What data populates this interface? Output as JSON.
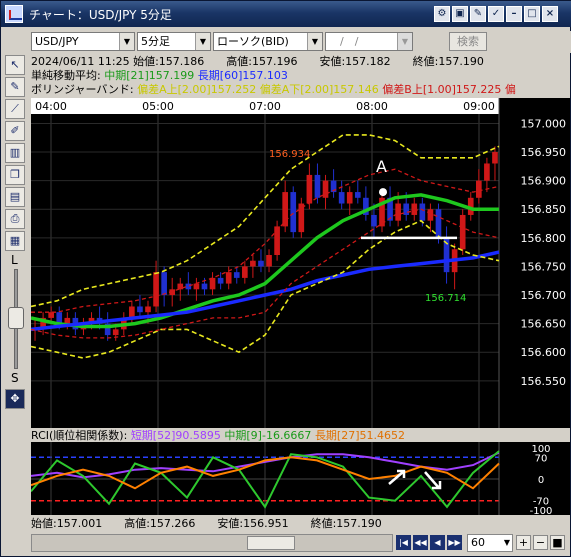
{
  "window": {
    "title": "チャート：USD/JPY 5分足",
    "buttons": [
      "gear-icon",
      "camera-icon",
      "palette-icon",
      "pin-icon",
      "minimize-icon",
      "restore-icon",
      "close-icon"
    ]
  },
  "toolbar": {
    "symbol": "USD/JPY",
    "timeframe": "5分足",
    "chart_type": "ローソク(BID)",
    "date_placeholder": "　/　/",
    "search_label": "検索"
  },
  "left_tools": {
    "icons": [
      "cursor-icon",
      "pen-icon",
      "trendline-icon",
      "draw-tool-icon",
      "bar-chart-icon",
      "copy-icon",
      "layers-icon",
      "print-icon",
      "save-icon"
    ],
    "large_label": "L",
    "small_label": "S",
    "move_icon": "move-icon"
  },
  "info": {
    "line1": "2024/06/11 11:25  始値:157.186　　高値:157.196　　安値:157.182　　終値:157.190",
    "ma_label": "単純移動平均:",
    "ma_mid": "中期[21]157.199",
    "ma_long": "長期[60]157.103",
    "bb_label": "ボリンジャーバンド:",
    "bb_upper_a": "偏差A上[2.00]157.252",
    "bb_lower_a": "偏差A下[2.00]157.146",
    "bb_upper_b": "偏差B上[1.00]157.225",
    "bb_cut": "偏"
  },
  "rci": {
    "label": "RCI(順位相関係数):",
    "short": "短期[52]90.5895",
    "mid": "中期[9]-16.6667",
    "long": "長期[27]51.4652",
    "levels": [
      "100",
      "70",
      "0",
      "-70",
      "-100"
    ]
  },
  "bottom": {
    "text": "始値:157.001　　高値:157.266　　安値:156.951　　終値:157.190",
    "zoom": "60"
  },
  "colors": {
    "ma_mid": "#1ec81e",
    "ma_long": "#1a2aff",
    "band_a": "#e8e81e",
    "band_b": "#d01818",
    "candle_up": "#d01818",
    "candle_down": "#2030d0",
    "rci_short": "#a040ff",
    "rci_mid": "#2ec82e",
    "rci_long": "#ff8000"
  },
  "chart_data": {
    "type": "line",
    "title": "USD/JPY 5分足",
    "x_ticks": [
      "04:00",
      "05:00",
      "07:00",
      "08:00",
      "09:00"
    ],
    "y_ticks": [
      156.55,
      156.6,
      156.65,
      156.7,
      156.75,
      156.8,
      156.85,
      156.9,
      156.95,
      157.0
    ],
    "ylim": [
      156.52,
      157.02
    ],
    "annotations": [
      "156.934",
      "156.714",
      "A"
    ],
    "candles": [
      [
        156.64,
        156.66,
        156.62,
        156.64
      ],
      [
        156.64,
        156.67,
        156.63,
        156.66
      ],
      [
        156.66,
        156.68,
        156.65,
        156.67
      ],
      [
        156.67,
        156.68,
        156.64,
        156.65
      ],
      [
        156.65,
        156.67,
        156.64,
        156.66
      ],
      [
        156.66,
        156.67,
        156.63,
        156.64
      ],
      [
        156.64,
        156.66,
        156.63,
        156.65
      ],
      [
        156.65,
        156.67,
        156.64,
        156.66
      ],
      [
        156.66,
        156.68,
        156.64,
        156.65
      ],
      [
        156.65,
        156.67,
        156.62,
        156.63
      ],
      [
        156.63,
        156.65,
        156.62,
        156.64
      ],
      [
        156.64,
        156.67,
        156.63,
        156.66
      ],
      [
        156.66,
        156.69,
        156.65,
        156.68
      ],
      [
        156.68,
        156.7,
        156.66,
        156.67
      ],
      [
        156.67,
        156.69,
        156.65,
        156.68
      ],
      [
        156.68,
        156.76,
        156.67,
        156.74
      ],
      [
        156.74,
        156.75,
        156.68,
        156.7
      ],
      [
        156.7,
        156.73,
        156.68,
        156.71
      ],
      [
        156.71,
        156.73,
        156.69,
        156.72
      ],
      [
        156.72,
        156.74,
        156.7,
        156.71
      ],
      [
        156.71,
        156.73,
        156.69,
        156.72
      ],
      [
        156.72,
        156.73,
        156.7,
        156.71
      ],
      [
        156.71,
        156.74,
        156.7,
        156.73
      ],
      [
        156.73,
        156.74,
        156.71,
        156.72
      ],
      [
        156.72,
        156.75,
        156.71,
        156.74
      ],
      [
        156.74,
        156.75,
        156.72,
        156.73
      ],
      [
        156.73,
        156.76,
        156.72,
        156.75
      ],
      [
        156.75,
        156.77,
        156.73,
        156.76
      ],
      [
        156.76,
        156.78,
        156.74,
        156.75
      ],
      [
        156.75,
        156.78,
        156.74,
        156.77
      ],
      [
        156.77,
        156.83,
        156.76,
        156.82
      ],
      [
        156.82,
        156.9,
        156.81,
        156.88
      ],
      [
        156.88,
        156.89,
        156.8,
        156.81
      ],
      [
        156.81,
        156.87,
        156.8,
        156.86
      ],
      [
        156.86,
        156.93,
        156.85,
        156.91
      ],
      [
        156.91,
        156.93,
        156.86,
        156.87
      ],
      [
        156.87,
        156.91,
        156.85,
        156.9
      ],
      [
        156.9,
        156.92,
        156.87,
        156.88
      ],
      [
        156.88,
        156.9,
        156.85,
        156.86
      ],
      [
        156.86,
        156.89,
        156.84,
        156.88
      ],
      [
        156.88,
        156.9,
        156.86,
        156.87
      ],
      [
        156.87,
        156.89,
        156.83,
        156.84
      ],
      [
        156.84,
        156.86,
        156.8,
        156.82
      ],
      [
        156.82,
        156.88,
        156.81,
        156.87
      ],
      [
        156.87,
        156.89,
        156.82,
        156.83
      ],
      [
        156.83,
        156.88,
        156.82,
        156.86
      ],
      [
        156.86,
        156.88,
        156.83,
        156.84
      ],
      [
        156.84,
        156.87,
        156.83,
        156.86
      ],
      [
        156.86,
        156.87,
        156.82,
        156.83
      ],
      [
        156.83,
        156.86,
        156.81,
        156.85
      ],
      [
        156.85,
        156.86,
        156.79,
        156.8
      ],
      [
        156.8,
        156.82,
        156.72,
        156.74
      ],
      [
        156.74,
        156.79,
        156.71,
        156.78
      ],
      [
        156.78,
        156.85,
        156.77,
        156.84
      ],
      [
        156.84,
        156.88,
        156.83,
        156.87
      ],
      [
        156.87,
        156.92,
        156.86,
        156.9
      ],
      [
        156.9,
        156.94,
        156.88,
        156.93
      ],
      [
        156.93,
        156.96,
        156.9,
        156.95
      ]
    ],
    "series": [
      {
        "name": "中期[21]",
        "values": [
          156.66,
          156.65,
          156.645,
          156.645,
          156.65,
          156.66,
          156.675,
          156.69,
          156.7,
          156.72,
          156.76,
          156.8,
          156.83,
          156.85,
          156.87,
          156.875,
          156.865,
          156.85,
          156.85
        ]
      },
      {
        "name": "長期[60]",
        "values": [
          156.64,
          156.645,
          156.65,
          156.655,
          156.66,
          156.665,
          156.67,
          156.68,
          156.69,
          156.7,
          156.71,
          156.725,
          156.735,
          156.745,
          156.75,
          156.755,
          156.76,
          156.765,
          156.775
        ]
      },
      {
        "name": "偏差A上[2.00]",
        "values": [
          156.68,
          156.69,
          156.71,
          156.72,
          156.73,
          156.74,
          156.76,
          156.79,
          156.82,
          156.87,
          156.92,
          156.95,
          156.98,
          156.98,
          156.97,
          156.94,
          156.94,
          156.94,
          156.96
        ]
      },
      {
        "name": "偏差A下[2.00]",
        "values": [
          156.61,
          156.6,
          156.59,
          156.6,
          156.62,
          156.64,
          156.64,
          156.62,
          156.6,
          156.63,
          156.7,
          156.72,
          156.74,
          156.78,
          156.81,
          156.83,
          156.79,
          156.77,
          156.76
        ]
      },
      {
        "name": "偏差B上[1.00]",
        "values": [
          156.67,
          156.67,
          156.68,
          156.685,
          156.69,
          156.7,
          156.715,
          156.73,
          156.75,
          156.79,
          156.84,
          156.87,
          156.89,
          156.91,
          156.92,
          156.9,
          156.89,
          156.88,
          156.89
        ]
      },
      {
        "name": "偏差B下[1.00]",
        "values": [
          156.64,
          156.63,
          156.625,
          156.625,
          156.63,
          156.64,
          156.65,
          156.66,
          156.66,
          156.67,
          156.72,
          156.75,
          156.78,
          156.81,
          156.84,
          156.85,
          156.83,
          156.81,
          156.8
        ]
      }
    ],
    "rci_series": [
      {
        "name": "短期[52]",
        "values": [
          10,
          20,
          5,
          15,
          30,
          35,
          30,
          25,
          40,
          55,
          70,
          80,
          80,
          70,
          55,
          40,
          30,
          45,
          85
        ]
      },
      {
        "name": "中期[9]",
        "values": [
          -40,
          60,
          10,
          -80,
          50,
          20,
          -60,
          70,
          30,
          -90,
          80,
          70,
          40,
          -60,
          -70,
          10,
          -90,
          20,
          90
        ]
      },
      {
        "name": "長期[27]",
        "values": [
          -20,
          10,
          30,
          10,
          -30,
          20,
          40,
          10,
          30,
          60,
          70,
          60,
          30,
          0,
          10,
          40,
          20,
          -30,
          50
        ]
      }
    ]
  }
}
